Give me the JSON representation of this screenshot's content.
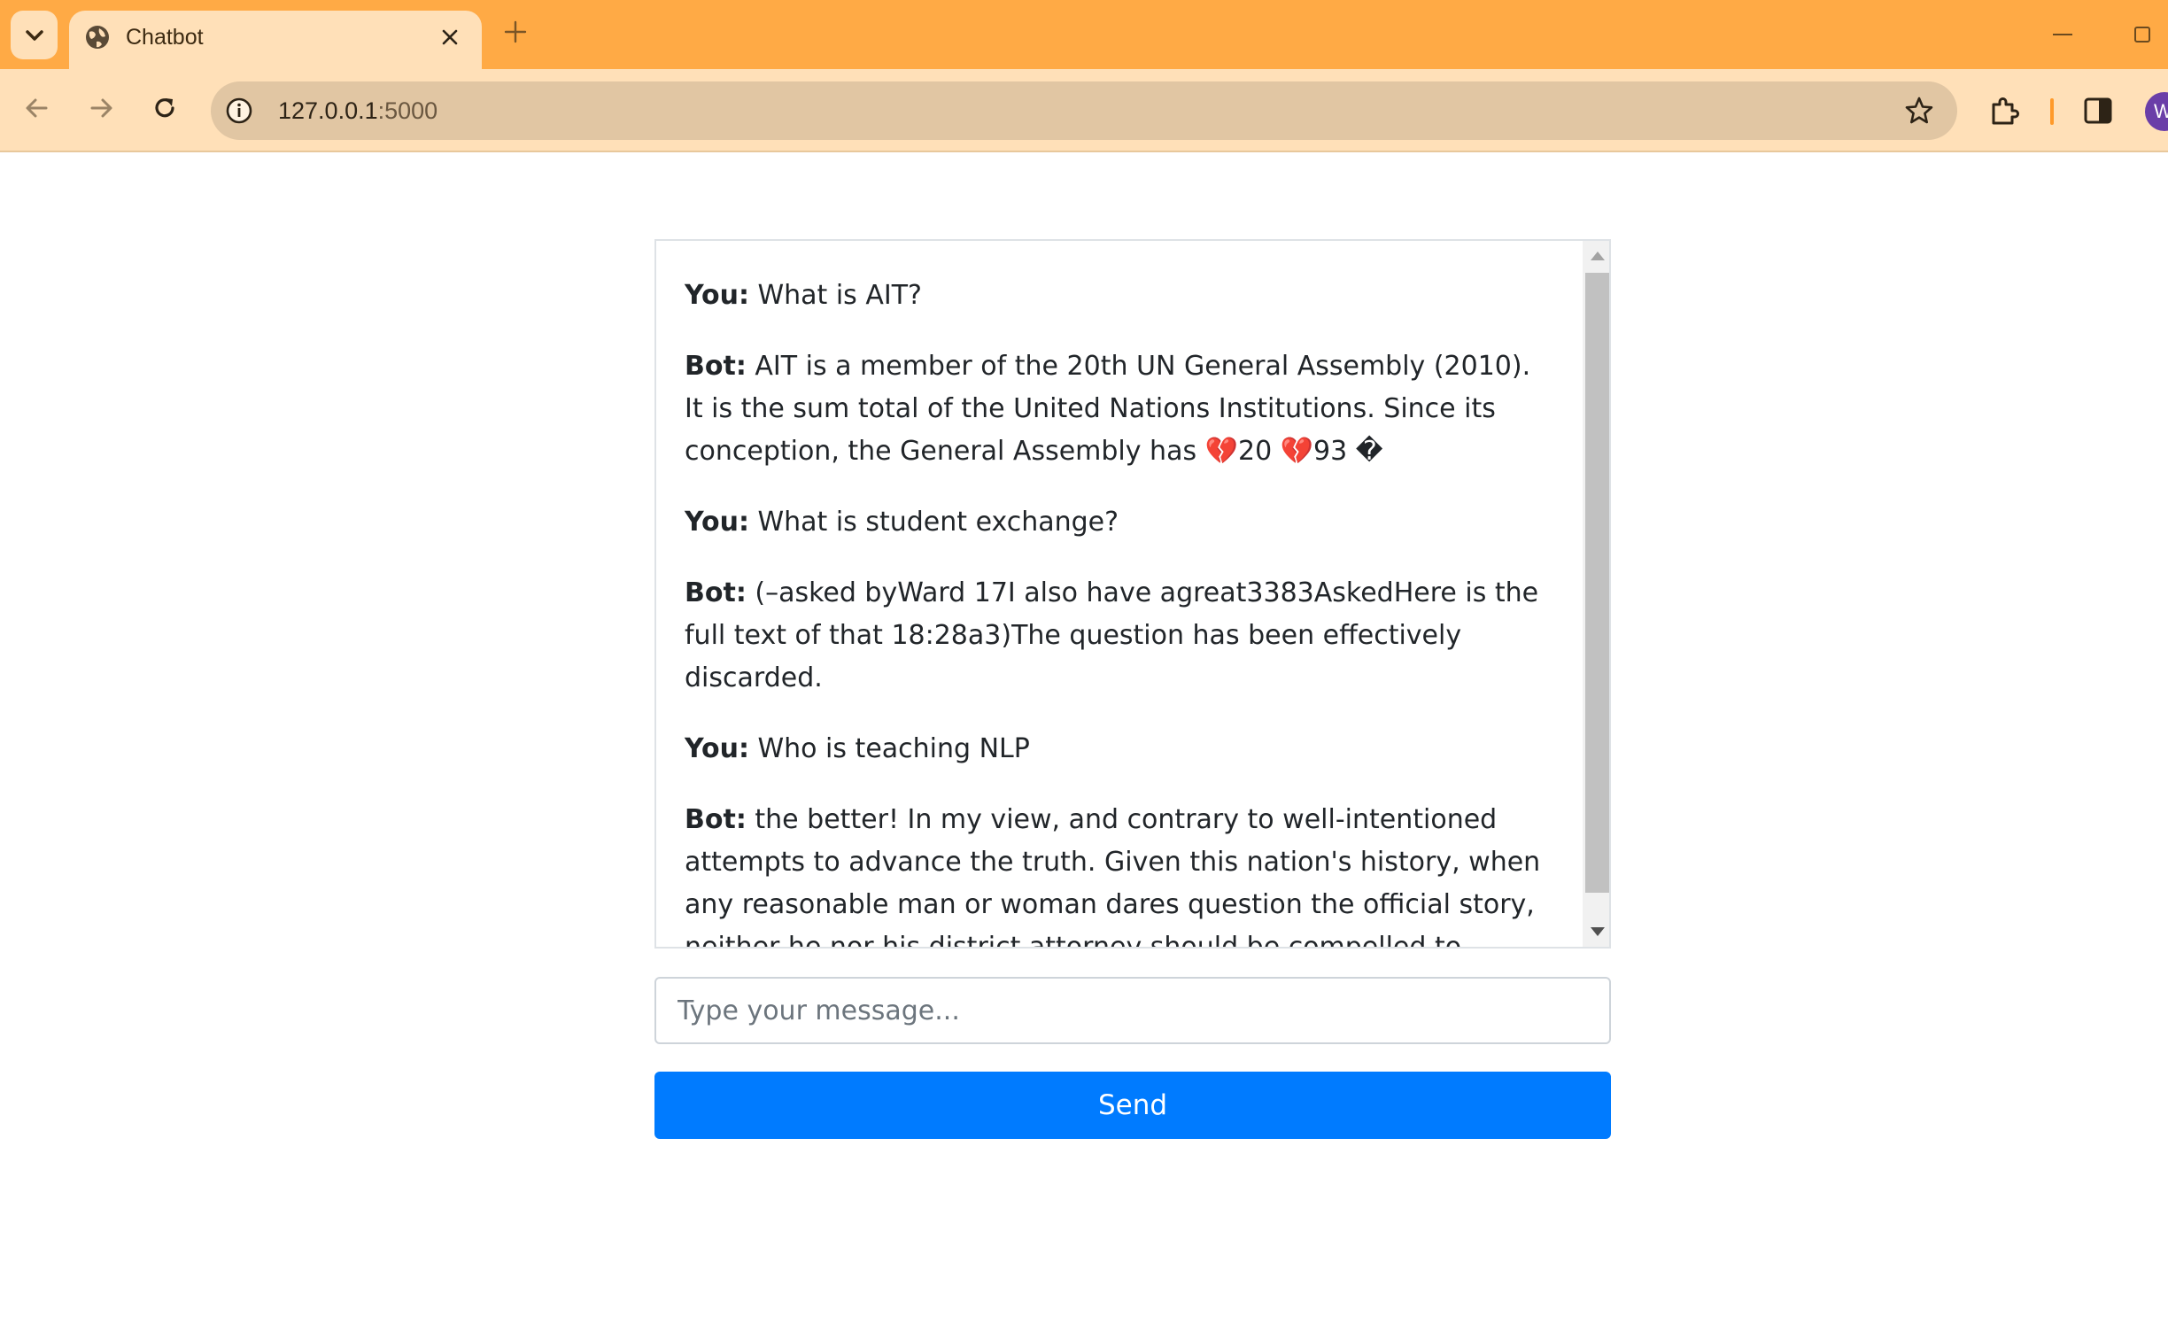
{
  "browser": {
    "tab_title": "Chatbot",
    "url_host": "127.0.0.1",
    "url_port": ":5000",
    "profile_initial": "W",
    "accent_color": "#ffaa45"
  },
  "icons": {
    "tab_search": "chevron-down-icon",
    "tab": "globe-icon",
    "close": "close-icon",
    "new_tab": "plus-icon",
    "back": "arrow-left-icon",
    "forward": "arrow-right-icon",
    "reload": "reload-icon",
    "site_info": "info-icon",
    "bookmark": "star-icon",
    "extensions": "puzzle-icon",
    "side_panel": "side-panel-icon"
  },
  "chat": {
    "messages": [
      {
        "speaker": "You:",
        "text": "What is AIT?"
      },
      {
        "speaker": "Bot:",
        "text": "AIT is a member of the 20th UN General Assembly (2010). It is the sum total of the United Nations Institutions. Since its conception, the General Assembly has 💔20 💔93 �"
      },
      {
        "speaker": "You:",
        "text": "What is student exchange?"
      },
      {
        "speaker": "Bot:",
        "text": "(–asked byWard 17I also have agreat3383AskedHere is the full text of that 18:28a3)The question has been effectively discarded."
      },
      {
        "speaker": "You:",
        "text": "Who is teaching NLP"
      },
      {
        "speaker": "Bot:",
        "text": "the better! In my view, and contrary to well-intentioned attempts to advance the truth. Given this nation's history, when any reasonable man or woman dares question the official story, neither he nor his district attorney should be compelled to"
      }
    ]
  },
  "input": {
    "value": "",
    "placeholder": "Type your message..."
  },
  "send_label": "Send",
  "colors": {
    "send_button": "#007bff"
  }
}
